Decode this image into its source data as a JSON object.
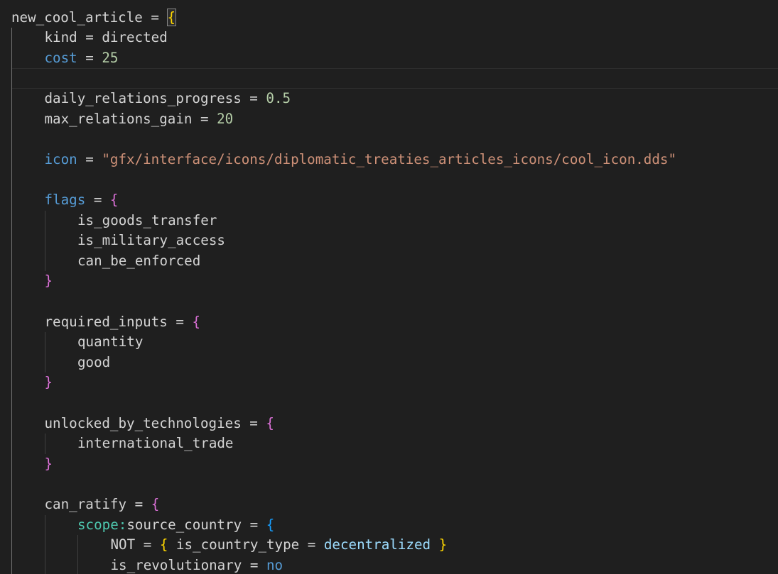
{
  "editor": {
    "lines": [
      {
        "indent": 0,
        "tokens": [
          {
            "t": "new_cool_article",
            "c": "t-plain"
          },
          {
            "t": " = ",
            "c": "t-plain"
          },
          {
            "t": "{",
            "c": "t-b1 bracket-match"
          }
        ]
      },
      {
        "indent": 1,
        "tokens": [
          {
            "t": "kind",
            "c": "t-plain"
          },
          {
            "t": " = ",
            "c": "t-plain"
          },
          {
            "t": "directed",
            "c": "t-plain"
          }
        ]
      },
      {
        "indent": 1,
        "tokens": [
          {
            "t": "cost",
            "c": "t-kw"
          },
          {
            "t": " = ",
            "c": "t-plain"
          },
          {
            "t": "25",
            "c": "t-num"
          }
        ]
      },
      {
        "indent": 0,
        "tokens": [],
        "current": true
      },
      {
        "indent": 1,
        "tokens": [
          {
            "t": "daily_relations_progress",
            "c": "t-plain"
          },
          {
            "t": " = ",
            "c": "t-plain"
          },
          {
            "t": "0.5",
            "c": "t-num"
          }
        ]
      },
      {
        "indent": 1,
        "tokens": [
          {
            "t": "max_relations_gain",
            "c": "t-plain"
          },
          {
            "t": " = ",
            "c": "t-plain"
          },
          {
            "t": "20",
            "c": "t-num"
          }
        ]
      },
      {
        "indent": 0,
        "tokens": []
      },
      {
        "indent": 1,
        "tokens": [
          {
            "t": "icon",
            "c": "t-kw"
          },
          {
            "t": " = ",
            "c": "t-plain"
          },
          {
            "t": "\"gfx/interface/icons/diplomatic_treaties_articles_icons/cool_icon.dds\"",
            "c": "t-str"
          }
        ]
      },
      {
        "indent": 0,
        "tokens": []
      },
      {
        "indent": 1,
        "tokens": [
          {
            "t": "flags",
            "c": "t-kw"
          },
          {
            "t": " = ",
            "c": "t-plain"
          },
          {
            "t": "{",
            "c": "t-b2"
          }
        ]
      },
      {
        "indent": 2,
        "tokens": [
          {
            "t": "is_goods_transfer",
            "c": "t-plain"
          }
        ]
      },
      {
        "indent": 2,
        "tokens": [
          {
            "t": "is_military_access",
            "c": "t-plain"
          }
        ]
      },
      {
        "indent": 2,
        "tokens": [
          {
            "t": "can_be_enforced",
            "c": "t-plain"
          }
        ]
      },
      {
        "indent": 1,
        "tokens": [
          {
            "t": "}",
            "c": "t-b2"
          }
        ]
      },
      {
        "indent": 0,
        "tokens": []
      },
      {
        "indent": 1,
        "tokens": [
          {
            "t": "required_inputs",
            "c": "t-plain"
          },
          {
            "t": " = ",
            "c": "t-plain"
          },
          {
            "t": "{",
            "c": "t-b2"
          }
        ]
      },
      {
        "indent": 2,
        "tokens": [
          {
            "t": "quantity",
            "c": "t-plain"
          }
        ]
      },
      {
        "indent": 2,
        "tokens": [
          {
            "t": "good",
            "c": "t-plain"
          }
        ]
      },
      {
        "indent": 1,
        "tokens": [
          {
            "t": "}",
            "c": "t-b2"
          }
        ]
      },
      {
        "indent": 0,
        "tokens": []
      },
      {
        "indent": 1,
        "tokens": [
          {
            "t": "unlocked_by_technologies",
            "c": "t-plain"
          },
          {
            "t": " = ",
            "c": "t-plain"
          },
          {
            "t": "{",
            "c": "t-b2"
          }
        ]
      },
      {
        "indent": 2,
        "tokens": [
          {
            "t": "international_trade",
            "c": "t-plain"
          }
        ]
      },
      {
        "indent": 1,
        "tokens": [
          {
            "t": "}",
            "c": "t-b2"
          }
        ]
      },
      {
        "indent": 0,
        "tokens": []
      },
      {
        "indent": 1,
        "tokens": [
          {
            "t": "can_ratify",
            "c": "t-plain"
          },
          {
            "t": " = ",
            "c": "t-plain"
          },
          {
            "t": "{",
            "c": "t-b2"
          }
        ]
      },
      {
        "indent": 2,
        "tokens": [
          {
            "t": "scope:",
            "c": "t-scope"
          },
          {
            "t": "source_country",
            "c": "t-plain"
          },
          {
            "t": " = ",
            "c": "t-plain"
          },
          {
            "t": "{",
            "c": "t-b3"
          }
        ]
      },
      {
        "indent": 3,
        "tokens": [
          {
            "t": "NOT",
            "c": "t-plain"
          },
          {
            "t": " = ",
            "c": "t-plain"
          },
          {
            "t": "{",
            "c": "t-b1"
          },
          {
            "t": " is_country_type",
            "c": "t-plain"
          },
          {
            "t": " = ",
            "c": "t-plain"
          },
          {
            "t": "decentralized",
            "c": "t-var"
          },
          {
            "t": " ",
            "c": "t-plain"
          },
          {
            "t": "}",
            "c": "t-b1"
          }
        ]
      },
      {
        "indent": 3,
        "tokens": [
          {
            "t": "is_revolutionary",
            "c": "t-plain"
          },
          {
            "t": " = ",
            "c": "t-plain"
          },
          {
            "t": "no",
            "c": "t-kw"
          }
        ]
      }
    ]
  },
  "colors": {
    "background": "#1f1f1f",
    "text": "#d4d4d4",
    "keyword": "#569cd6",
    "number": "#b5cea8",
    "string": "#ce9178",
    "scope": "#4ec9b0",
    "bracket_level1": "#ffd700",
    "bracket_level2": "#da70d6",
    "bracket_level3": "#179fff"
  }
}
